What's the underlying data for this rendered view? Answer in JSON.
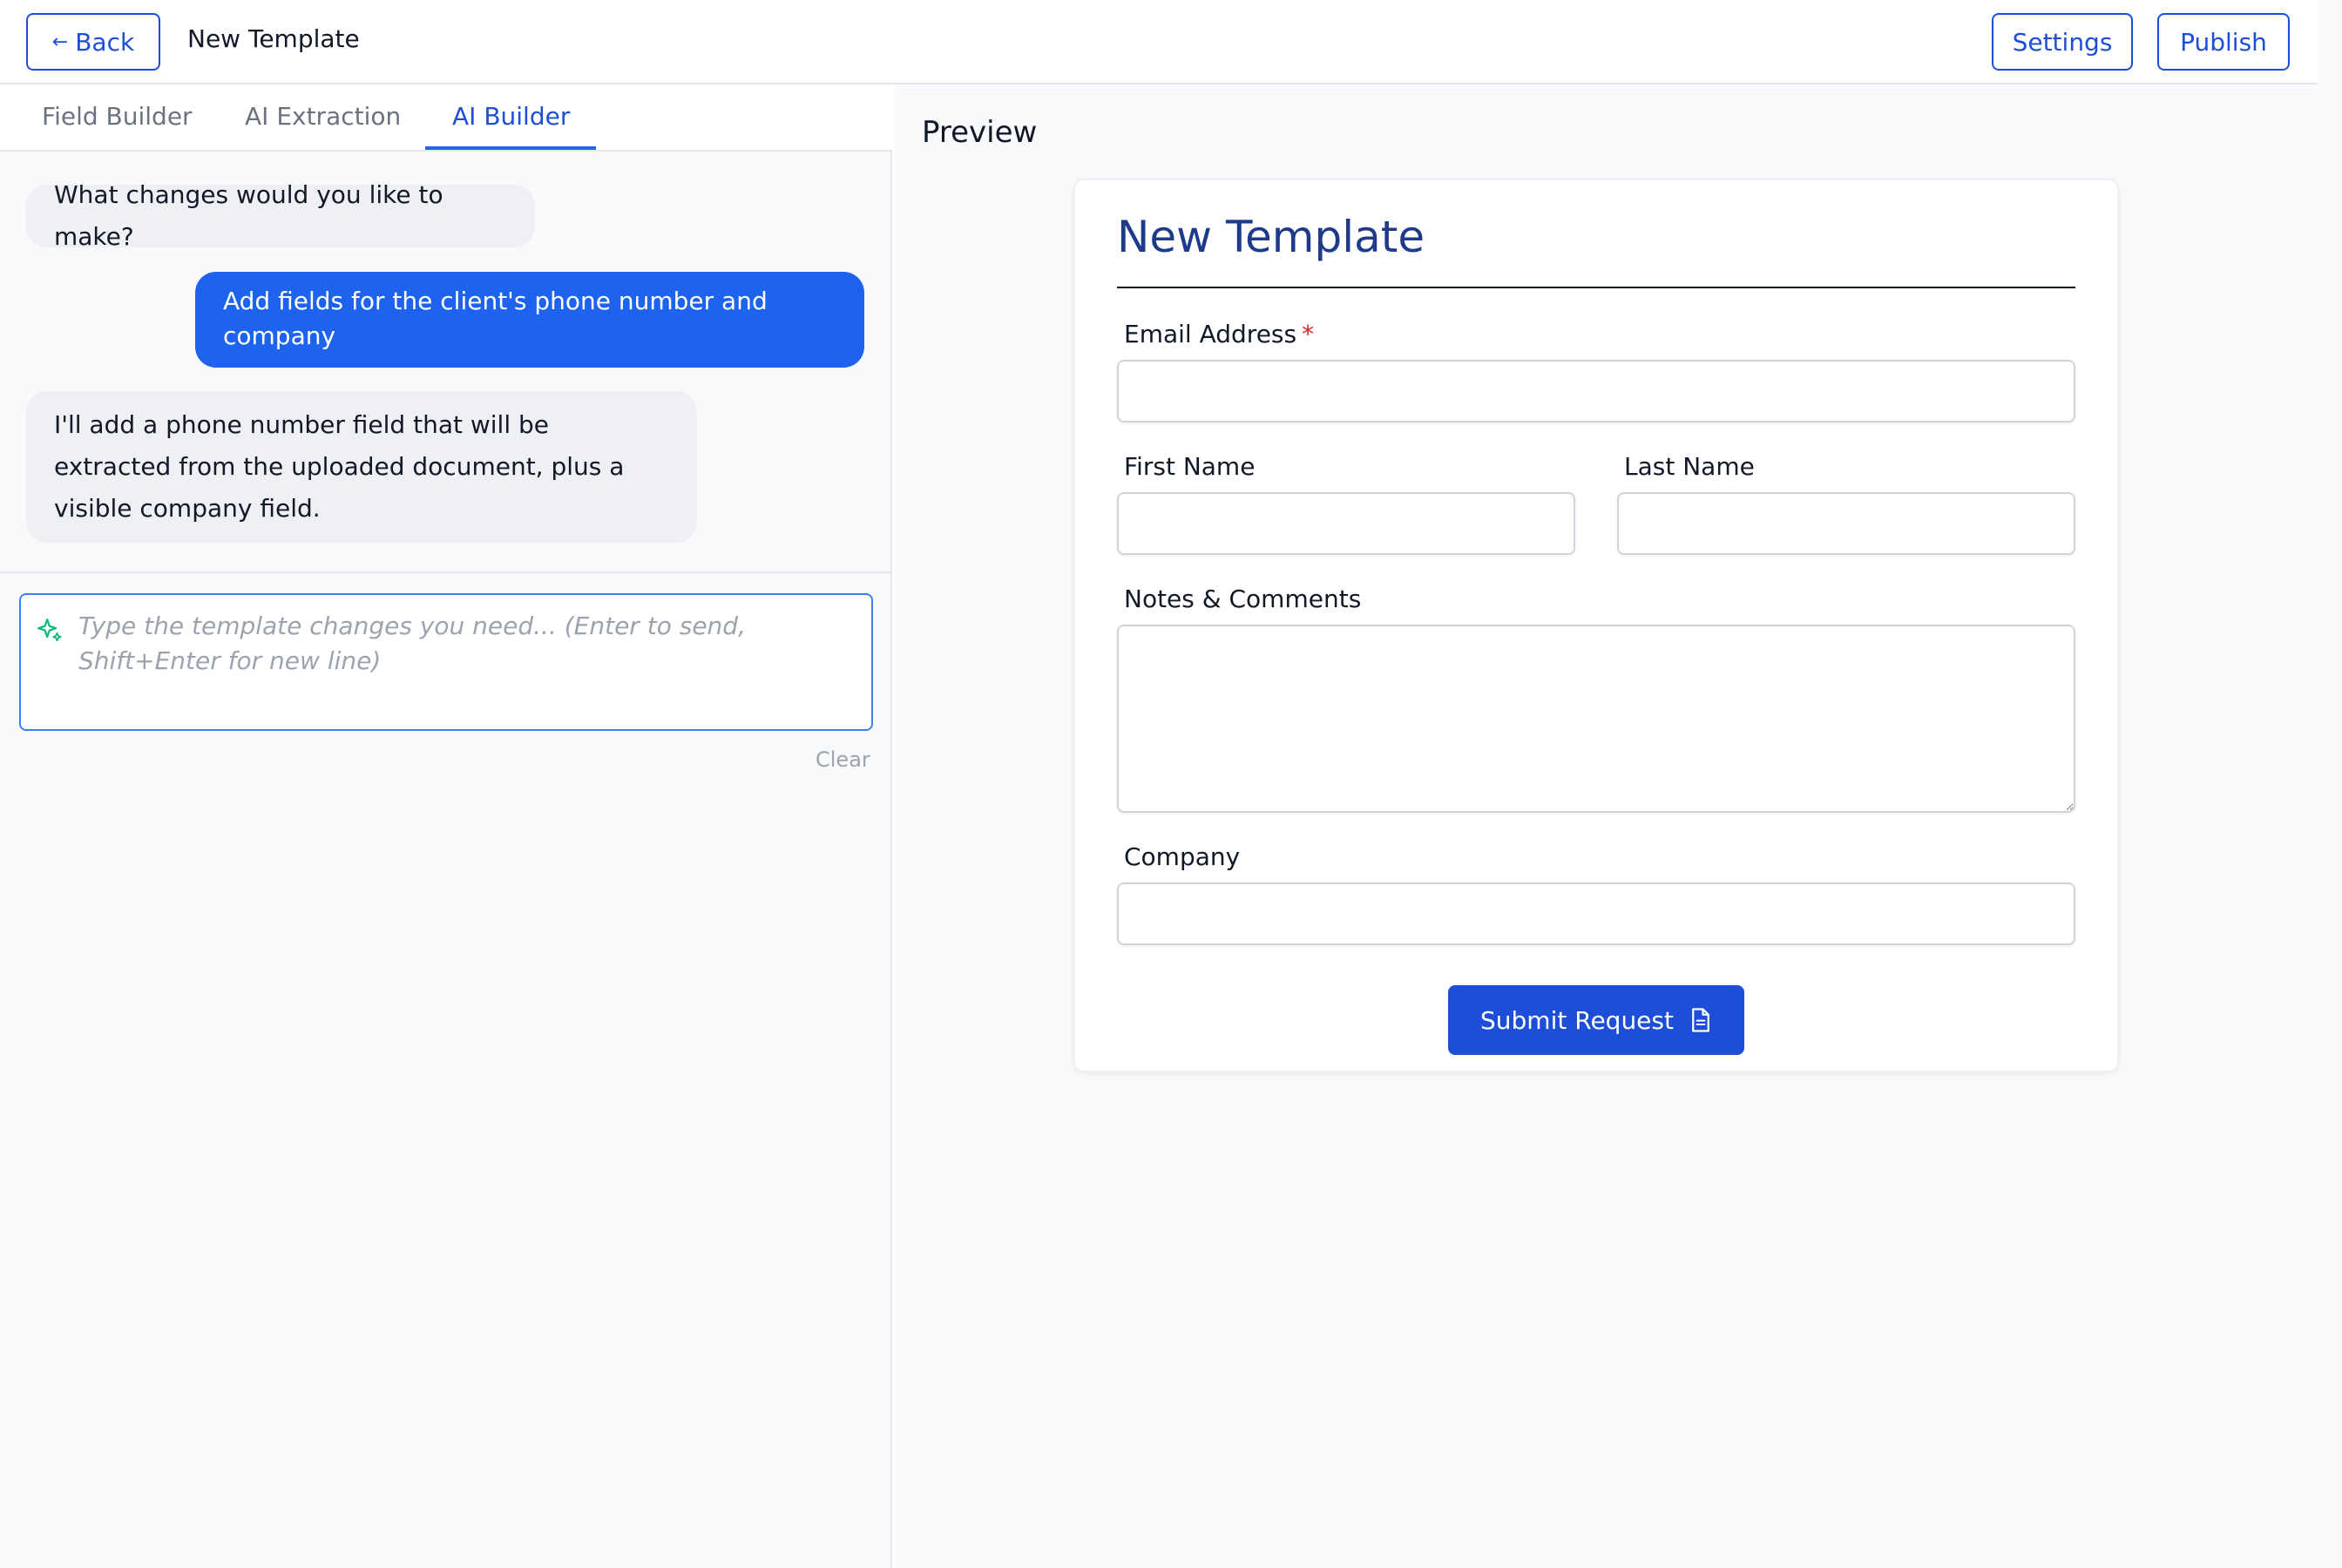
{
  "header": {
    "back_label": "Back",
    "back_arrow": "←",
    "title": "New Template",
    "settings_label": "Settings",
    "publish_label": "Publish"
  },
  "tabs": [
    {
      "label": "Field Builder",
      "active": false
    },
    {
      "label": "AI Extraction",
      "active": false
    },
    {
      "label": "AI Builder",
      "active": true
    }
  ],
  "chat": {
    "messages": [
      {
        "role": "assistant",
        "text": "What changes would you like to make?"
      },
      {
        "role": "user",
        "text": "Add fields for the client's phone number and company"
      },
      {
        "role": "assistant",
        "text": "I'll add a phone number field that will be extracted from the uploaded document, plus a visible company field."
      }
    ],
    "input_placeholder": "Type the template changes you need... (Enter to send, Shift+Enter for new line)",
    "input_value": "",
    "clear_label": "Clear",
    "input_icon": "sparkle-icon"
  },
  "preview": {
    "label": "Preview",
    "form": {
      "title": "New Template",
      "fields": {
        "email": {
          "label": "Email Address",
          "required_mark": "*",
          "value": ""
        },
        "first_name": {
          "label": "First Name",
          "value": ""
        },
        "last_name": {
          "label": "Last Name",
          "value": ""
        },
        "notes": {
          "label": "Notes & Comments",
          "value": ""
        },
        "company": {
          "label": "Company",
          "value": ""
        }
      },
      "submit_label": "Submit Request",
      "submit_icon": "document-icon"
    }
  },
  "colors": {
    "accent": "#1d4ed8",
    "user_bubble": "#1d63ed",
    "assistant_bubble": "#eef0f3",
    "form_title": "#1e3a8a",
    "required": "#dc2626",
    "sparkle": "#10b981"
  }
}
